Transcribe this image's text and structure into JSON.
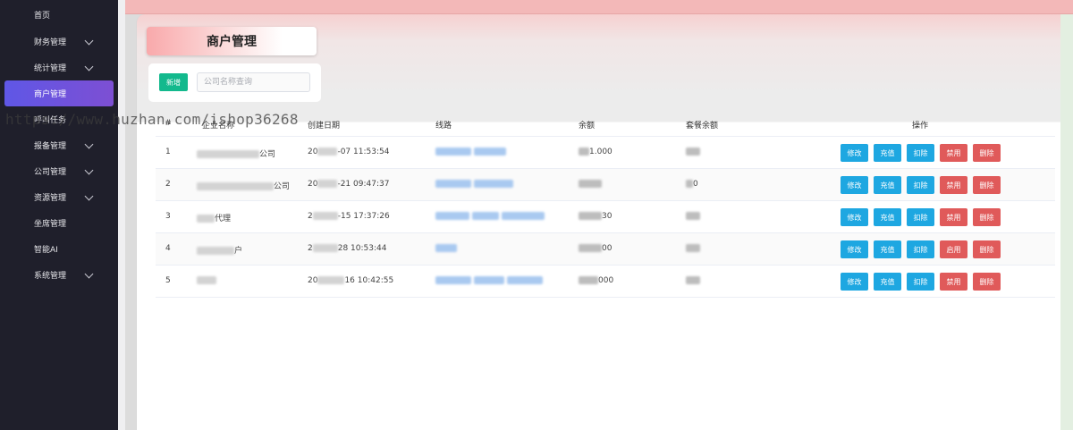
{
  "sidebar": {
    "items": [
      {
        "label": "首页",
        "has_children": false,
        "active": false
      },
      {
        "label": "财务管理",
        "has_children": true,
        "active": false
      },
      {
        "label": "统计管理",
        "has_children": true,
        "active": false
      },
      {
        "label": "商户管理",
        "has_children": false,
        "active": true
      },
      {
        "label": "呼叫任务",
        "has_children": false,
        "active": false
      },
      {
        "label": "报备管理",
        "has_children": true,
        "active": false
      },
      {
        "label": "公司管理",
        "has_children": true,
        "active": false
      },
      {
        "label": "资源管理",
        "has_children": true,
        "active": false
      },
      {
        "label": "坐席管理",
        "has_children": false,
        "active": false
      },
      {
        "label": "智能AI",
        "has_children": false,
        "active": false
      },
      {
        "label": "系统管理",
        "has_children": true,
        "active": false
      }
    ]
  },
  "page": {
    "title": "商户管理"
  },
  "toolbar": {
    "add_label": "新增",
    "search_placeholder": "公司名称查询",
    "search_value": ""
  },
  "table": {
    "columns": [
      "#",
      "企业名称",
      "创建日期",
      "线路",
      "余额",
      "套餐余额",
      "操作"
    ],
    "rows": [
      {
        "index": "1",
        "name_visible": "公司",
        "date_prefix": "20",
        "date_suffix": "-07 11:53:54",
        "balance_visible": "1.000",
        "package_visible": "",
        "toggle_label": "禁用"
      },
      {
        "index": "2",
        "name_visible": "公司",
        "date_prefix": "20",
        "date_suffix": "-21 09:47:37",
        "balance_visible": "",
        "package_visible": "0",
        "toggle_label": "禁用"
      },
      {
        "index": "3",
        "name_visible": "代理",
        "date_prefix": "2",
        "date_suffix": "-15 17:37:26",
        "balance_visible": "30",
        "package_visible": "",
        "toggle_label": "禁用"
      },
      {
        "index": "4",
        "name_visible": "户",
        "date_prefix": "2",
        "date_suffix": "28 10:53:44",
        "balance_visible": "00",
        "package_visible": "",
        "toggle_label": "启用"
      },
      {
        "index": "5",
        "name_visible": "",
        "date_prefix": "20",
        "date_suffix": "16 10:42:55",
        "balance_visible": "000",
        "package_visible": "",
        "toggle_label": "禁用"
      }
    ],
    "actions": {
      "edit": "修改",
      "recharge": "充值",
      "deduct": "扣除",
      "delete": "删除"
    }
  },
  "watermark": "https://www.huzhan.com/ishop36268",
  "colors": {
    "sidebar_bg": "#1f1f2b",
    "active_nav_start": "#5f57e6",
    "active_nav_end": "#7d4fd3",
    "add_button": "#13b98d",
    "action_blue": "#1ea7e1",
    "action_red": "#e05a5a"
  }
}
